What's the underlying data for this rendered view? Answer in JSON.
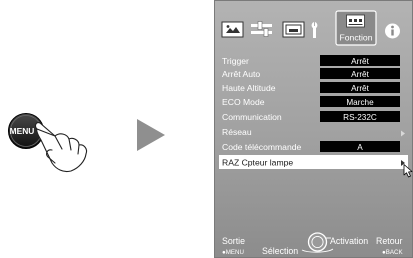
{
  "remote": {
    "button_label": "MENU"
  },
  "menu": {
    "active_tab": "Fonction",
    "rows": [
      {
        "label": "Trigger",
        "value": "Arrêt"
      },
      {
        "label": "Arrêt Auto",
        "value": "Arrêt"
      },
      {
        "label": "Haute Altitude",
        "value": "Arrêt"
      },
      {
        "label": "ECO Mode",
        "value": "Marche"
      },
      {
        "label": "Communication",
        "value": "RS-232C"
      },
      {
        "label": "Réseau",
        "value": ""
      },
      {
        "label": "Code télécommande",
        "value": "A"
      }
    ],
    "selected_row": {
      "label": "RAZ Cpteur lampe"
    },
    "footer": {
      "exit": "Sortie",
      "exit_key": "●MENU",
      "select": "Sélection",
      "activate": "Activation",
      "back": "Retour",
      "back_key": "●BACK"
    }
  }
}
